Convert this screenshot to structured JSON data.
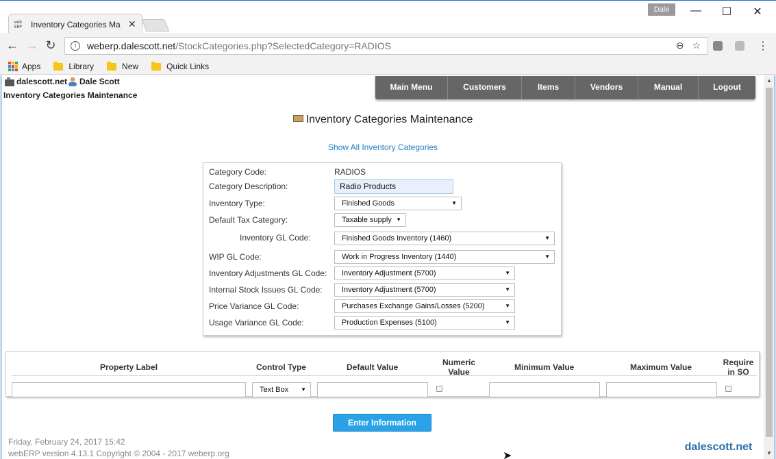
{
  "browser": {
    "tab_title": "Inventory Categories Ma",
    "favicon_text": "web ERP",
    "tab_close": "✕",
    "profile_name": "Dale",
    "url_host": "weberp.dalescott.net",
    "url_path": "/StockCategories.php?SelectedCategory=RADIOS",
    "bookmarks": [
      "Apps",
      "Library",
      "New",
      "Quick Links"
    ]
  },
  "header": {
    "site": "dalescott.net",
    "user": "Dale Scott",
    "page_crumb": "Inventory Categories Maintenance"
  },
  "nav": [
    "Main Menu",
    "Customers",
    "Items",
    "Vendors",
    "Manual",
    "Logout"
  ],
  "page": {
    "title": "Inventory Categories Maintenance",
    "show_all_link": "Show All Inventory Categories"
  },
  "form": {
    "category_code_label": "Category Code:",
    "category_code_value": "RADIOS",
    "category_description_label": "Category Description:",
    "category_description_value": "Radio Products",
    "inventory_type_label": "Inventory Type:",
    "inventory_type_value": "Finished Goods",
    "default_tax_label": "Default Tax Category:",
    "default_tax_value": "Taxable supply",
    "inventory_gl_label": "Inventory GL Code:",
    "inventory_gl_value": "Finished Goods Inventory (1460)",
    "wip_gl_label": "WIP GL Code:",
    "wip_gl_value": "Work in Progress Inventory (1440)",
    "inv_adj_gl_label": "Inventory Adjustments GL Code:",
    "inv_adj_gl_value": "Inventory Adjustment (5700)",
    "int_stock_gl_label": "Internal Stock Issues GL Code:",
    "int_stock_gl_value": "Inventory Adjustment (5700)",
    "price_var_gl_label": "Price Variance GL Code:",
    "price_var_gl_value": "Purchases Exchange Gains/Losses (5200)",
    "usage_var_gl_label": "Usage Variance GL Code:",
    "usage_var_gl_value": "Production Expenses (5100)"
  },
  "properties": {
    "headers": {
      "label": "Property Label",
      "control": "Control Type",
      "default": "Default Value",
      "numeric_1": "Numeric",
      "numeric_2": "Value",
      "min": "Minimum Value",
      "max": "Maximum Value",
      "require_1": "Require",
      "require_2": "in SO"
    },
    "control_type_value": "Text Box"
  },
  "submit_label": "Enter Information",
  "footer": {
    "date": "Friday, February 24, 2017 15:42",
    "copyright": "webERP version 4.13.1 Copyright © 2004 - 2017 weberp.org",
    "watermark": "dalescott.net"
  },
  "colors": {
    "nav_bg": "#666666",
    "link": "#1f7fc0",
    "button": "#2aa2e8",
    "window_border": "#1a6fc9"
  }
}
